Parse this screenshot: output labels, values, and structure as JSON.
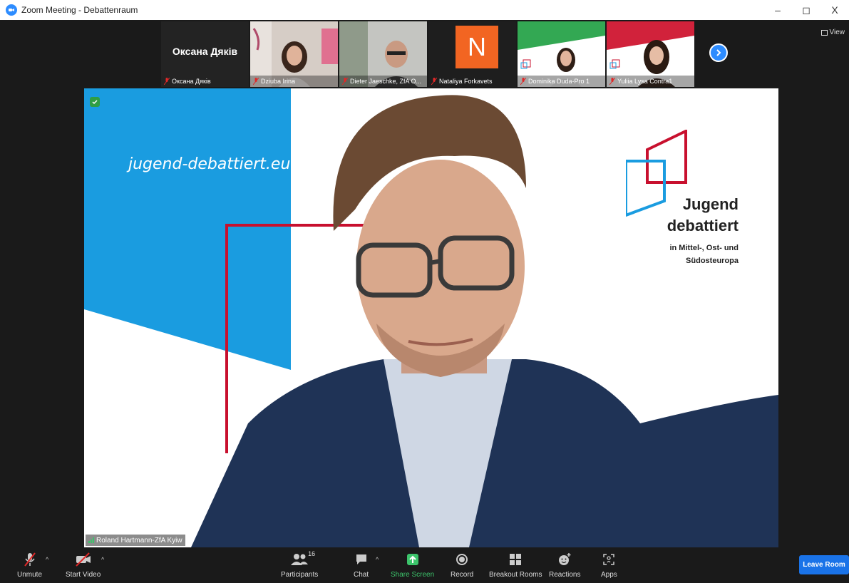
{
  "window": {
    "title": "Zoom Meeting - Debattenraum",
    "minimize": "–",
    "maximize": "◻",
    "close": "X"
  },
  "view_button": {
    "label": "View"
  },
  "participants_strip": [
    {
      "name": "Оксана Дяків",
      "display_text": "Оксана Дяків",
      "type": "text"
    },
    {
      "name": "Dziuba Irina",
      "type": "video",
      "bg": "#c9c2bb"
    },
    {
      "name": "Dieter Jaeschke, ZfA O...",
      "type": "video",
      "bg": "#b7b8b4"
    },
    {
      "name": "Nataliya Forkavets",
      "type": "avatar",
      "initial": "N",
      "bg": "#f26522"
    },
    {
      "name": "Dominika Duda-Pro 1",
      "type": "video",
      "bg": "#33a853",
      "tag": "PRO"
    },
    {
      "name": "Yuliia Lysa Contra1",
      "type": "video",
      "bg": "#d1223b",
      "tag": "CONTRA"
    }
  ],
  "main_video": {
    "website": "jugend-debattiert.eu",
    "brand_line1": "Jugend",
    "brand_line2": "debattiert",
    "brand_line3": "in Mittel-, Ost- und",
    "brand_line4": "Südosteuropa",
    "speaker_name": "Roland Hartmann-ZfA Kyiw",
    "colors": {
      "blue": "#1a9ce0",
      "red": "#c8102e",
      "skin": "#d9a88c",
      "suit": "#1f3356",
      "hair": "#6b4a33"
    }
  },
  "toolbar": {
    "unmute": "Unmute",
    "start_video": "Start Video",
    "participants": "Participants",
    "participants_count": "16",
    "chat": "Chat",
    "share_screen": "Share Screen",
    "record": "Record",
    "breakout_rooms": "Breakout Rooms",
    "reactions": "Reactions",
    "apps": "Apps",
    "leave_room": "Leave Room"
  }
}
